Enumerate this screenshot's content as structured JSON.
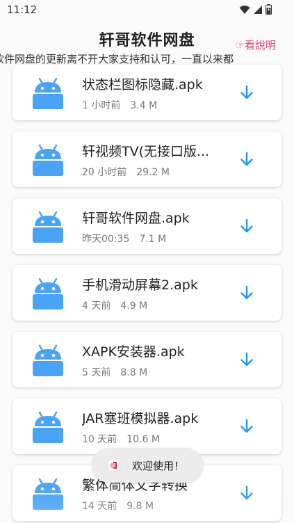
{
  "status_bar": {
    "time": "11:12"
  },
  "header": {
    "title": "轩哥软件网盘",
    "help_label": "☞看說明",
    "marquee": "软件网盘的更新离不开大家支持和认可，一直以来都"
  },
  "files": [
    {
      "name": "状态栏图标隐藏.apk",
      "time": "1 小时前",
      "size": "3.4 M"
    },
    {
      "name": "轩视频TV(无接口版...",
      "time": "20 小时前",
      "size": "29.2 M"
    },
    {
      "name": "轩哥软件网盘.apk",
      "time": "昨天00:35",
      "size": "7.1 M"
    },
    {
      "name": "手机滑动屏幕2.apk",
      "time": "4 天前",
      "size": "4.9 M"
    },
    {
      "name": "XAPK安装器.apk",
      "time": "5 天前",
      "size": "8.8 M"
    },
    {
      "name": "JAR塞班模拟器.apk",
      "time": "10 天前",
      "size": "10.6 M"
    },
    {
      "name": "繁体简体文字转换",
      "time": "14 天前",
      "size": "9.8 M"
    }
  ],
  "toast": {
    "text": "欢迎使用！"
  },
  "colors": {
    "android_icon": "#4aa3f5",
    "download_icon": "#2196f3",
    "help_link": "#e0457b"
  }
}
